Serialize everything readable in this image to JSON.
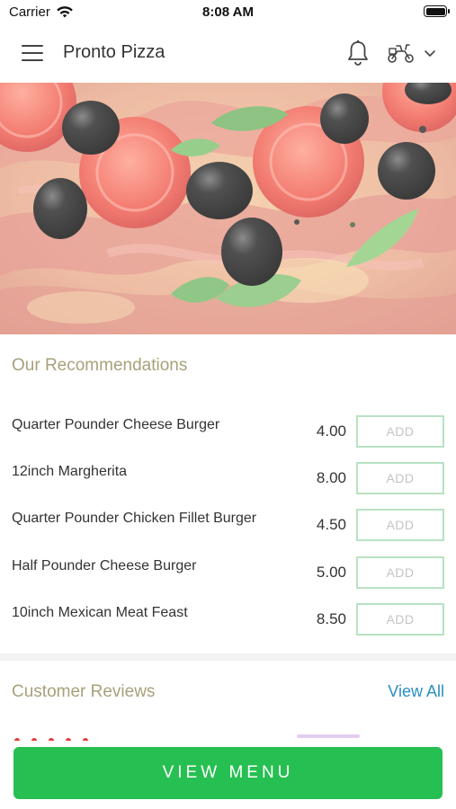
{
  "status_bar": {
    "carrier": "Carrier",
    "time": "8:08 AM"
  },
  "header": {
    "title": "Pronto Pizza"
  },
  "recommendations": {
    "title": "Our Recommendations",
    "items": [
      {
        "name": "Quarter Pounder Cheese Burger",
        "price": "4.00",
        "button": "ADD"
      },
      {
        "name": "12inch Margherita",
        "price": "8.00",
        "button": "ADD"
      },
      {
        "name": "Quarter Pounder Chicken Fillet Burger",
        "price": "4.50",
        "button": "ADD"
      },
      {
        "name": "Half Pounder Cheese Burger",
        "price": "5.00",
        "button": "ADD"
      },
      {
        "name": "10inch Mexican Meat Feast",
        "price": "8.50",
        "button": "ADD"
      }
    ]
  },
  "reviews": {
    "title": "Customer Reviews",
    "view_all": "View All"
  },
  "bottom": {
    "view_menu": "VIEW MENU"
  },
  "colors": {
    "accent_green": "#26bf52",
    "section_title": "#a7a17a",
    "link_blue": "#2a8fc0"
  }
}
